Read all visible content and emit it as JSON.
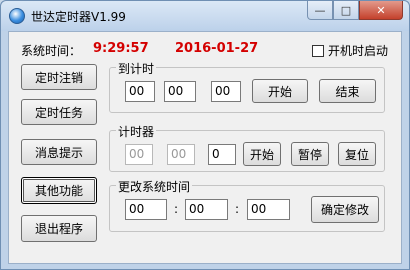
{
  "window": {
    "title": "世达定时器V1.99"
  },
  "status": {
    "time_label": "系统时间：",
    "time_value": "9:29:57",
    "date_value": "2016-01-27",
    "startup_label": "开机时启动"
  },
  "sidebar": {
    "buttons": [
      "定时注销",
      "定时任务",
      "消息提示",
      "其他功能",
      "退出程序"
    ]
  },
  "countdown": {
    "title": "到计时",
    "hours": "00",
    "minutes": "00",
    "seconds": "00",
    "start": "开始",
    "end": "结束"
  },
  "stopwatch": {
    "title": "计时器",
    "hours": "00",
    "minutes": "00",
    "seconds": "0",
    "start": "开始",
    "pause": "暂停",
    "reset": "复位"
  },
  "change_time": {
    "title": "更改系统时间",
    "hours": "00",
    "minutes": "00",
    "seconds": "00",
    "separator": ":",
    "confirm": "确定修改"
  }
}
